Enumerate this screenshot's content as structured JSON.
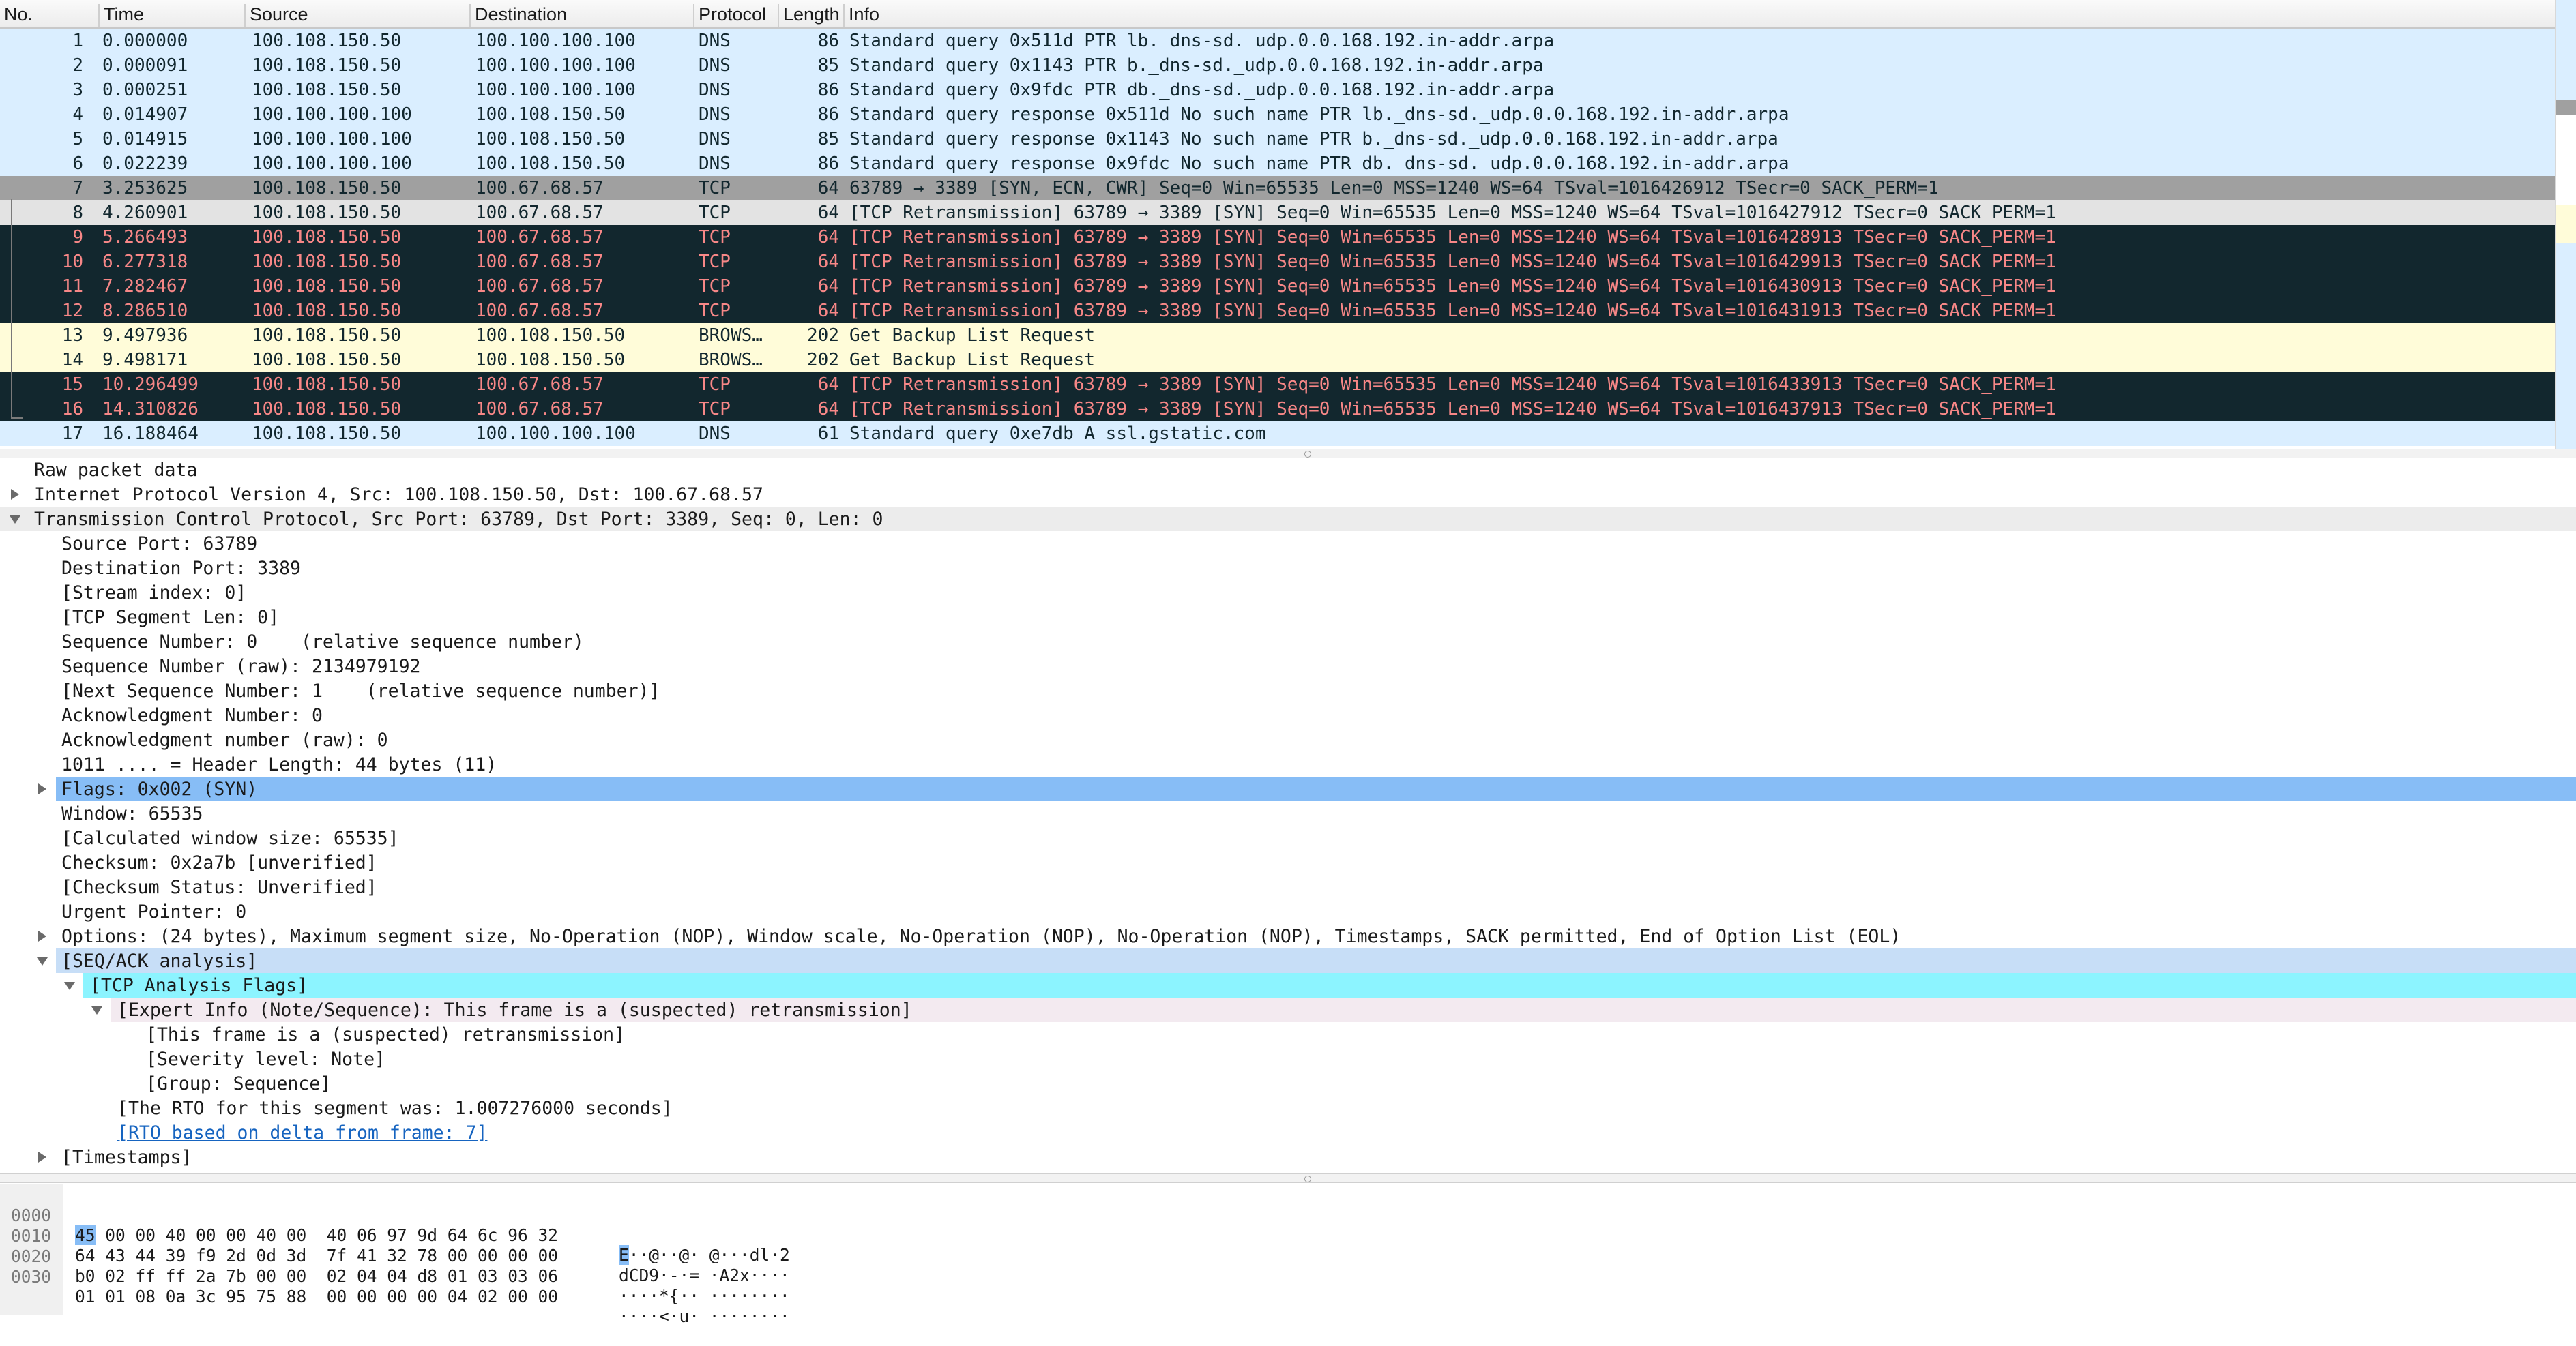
{
  "packet_list": {
    "columns": {
      "no": "No.",
      "time": "Time",
      "source": "Source",
      "destination": "Destination",
      "protocol": "Protocol",
      "length": "Length",
      "info": "Info"
    },
    "rows": [
      {
        "no": "1",
        "time": "0.000000",
        "src": "100.108.150.50",
        "dst": "100.100.100.100",
        "proto": "DNS",
        "len": "86",
        "info": "Standard query 0x511d PTR lb._dns-sd._udp.0.0.168.192.in-addr.arpa"
      },
      {
        "no": "2",
        "time": "0.000091",
        "src": "100.108.150.50",
        "dst": "100.100.100.100",
        "proto": "DNS",
        "len": "85",
        "info": "Standard query 0x1143 PTR b._dns-sd._udp.0.0.168.192.in-addr.arpa"
      },
      {
        "no": "3",
        "time": "0.000251",
        "src": "100.108.150.50",
        "dst": "100.100.100.100",
        "proto": "DNS",
        "len": "86",
        "info": "Standard query 0x9fdc PTR db._dns-sd._udp.0.0.168.192.in-addr.arpa"
      },
      {
        "no": "4",
        "time": "0.014907",
        "src": "100.100.100.100",
        "dst": "100.108.150.50",
        "proto": "DNS",
        "len": "86",
        "info": "Standard query response 0x511d No such name PTR lb._dns-sd._udp.0.0.168.192.in-addr.arpa"
      },
      {
        "no": "5",
        "time": "0.014915",
        "src": "100.100.100.100",
        "dst": "100.108.150.50",
        "proto": "DNS",
        "len": "85",
        "info": "Standard query response 0x1143 No such name PTR b._dns-sd._udp.0.0.168.192.in-addr.arpa"
      },
      {
        "no": "6",
        "time": "0.022239",
        "src": "100.100.100.100",
        "dst": "100.108.150.50",
        "proto": "DNS",
        "len": "86",
        "info": "Standard query response 0x9fdc No such name PTR db._dns-sd._udp.0.0.168.192.in-addr.arpa"
      },
      {
        "no": "7",
        "time": "3.253625",
        "src": "100.108.150.50",
        "dst": "100.67.68.57",
        "proto": "TCP",
        "len": "64",
        "info": "63789 → 3389 [SYN, ECN, CWR] Seq=0 Win=65535 Len=0 MSS=1240 WS=64 TSval=1016426912 TSecr=0 SACK_PERM=1"
      },
      {
        "no": "8",
        "time": "4.260901",
        "src": "100.108.150.50",
        "dst": "100.67.68.57",
        "proto": "TCP",
        "len": "64",
        "info": "[TCP Retransmission] 63789 → 3389 [SYN] Seq=0 Win=65535 Len=0 MSS=1240 WS=64 TSval=1016427912 TSecr=0 SACK_PERM=1"
      },
      {
        "no": "9",
        "time": "5.266493",
        "src": "100.108.150.50",
        "dst": "100.67.68.57",
        "proto": "TCP",
        "len": "64",
        "info": "[TCP Retransmission] 63789 → 3389 [SYN] Seq=0 Win=65535 Len=0 MSS=1240 WS=64 TSval=1016428913 TSecr=0 SACK_PERM=1"
      },
      {
        "no": "10",
        "time": "6.277318",
        "src": "100.108.150.50",
        "dst": "100.67.68.57",
        "proto": "TCP",
        "len": "64",
        "info": "[TCP Retransmission] 63789 → 3389 [SYN] Seq=0 Win=65535 Len=0 MSS=1240 WS=64 TSval=1016429913 TSecr=0 SACK_PERM=1"
      },
      {
        "no": "11",
        "time": "7.282467",
        "src": "100.108.150.50",
        "dst": "100.67.68.57",
        "proto": "TCP",
        "len": "64",
        "info": "[TCP Retransmission] 63789 → 3389 [SYN] Seq=0 Win=65535 Len=0 MSS=1240 WS=64 TSval=1016430913 TSecr=0 SACK_PERM=1"
      },
      {
        "no": "12",
        "time": "8.286510",
        "src": "100.108.150.50",
        "dst": "100.67.68.57",
        "proto": "TCP",
        "len": "64",
        "info": "[TCP Retransmission] 63789 → 3389 [SYN] Seq=0 Win=65535 Len=0 MSS=1240 WS=64 TSval=1016431913 TSecr=0 SACK_PERM=1"
      },
      {
        "no": "13",
        "time": "9.497936",
        "src": "100.108.150.50",
        "dst": "100.108.150.50",
        "proto": "BROWS…",
        "len": "202",
        "info": "Get Backup List Request"
      },
      {
        "no": "14",
        "time": "9.498171",
        "src": "100.108.150.50",
        "dst": "100.108.150.50",
        "proto": "BROWS…",
        "len": "202",
        "info": "Get Backup List Request"
      },
      {
        "no": "15",
        "time": "10.296499",
        "src": "100.108.150.50",
        "dst": "100.67.68.57",
        "proto": "TCP",
        "len": "64",
        "info": "[TCP Retransmission] 63789 → 3389 [SYN] Seq=0 Win=65535 Len=0 MSS=1240 WS=64 TSval=1016433913 TSecr=0 SACK_PERM=1"
      },
      {
        "no": "16",
        "time": "14.310826",
        "src": "100.108.150.50",
        "dst": "100.67.68.57",
        "proto": "TCP",
        "len": "64",
        "info": "[TCP Retransmission] 63789 → 3389 [SYN] Seq=0 Win=65535 Len=0 MSS=1240 WS=64 TSval=1016437913 TSecr=0 SACK_PERM=1"
      },
      {
        "no": "17",
        "time": "16.188464",
        "src": "100.108.150.50",
        "dst": "100.100.100.100",
        "proto": "DNS",
        "len": "61",
        "info": "Standard query 0xe7db A ssl.gstatic.com"
      }
    ]
  },
  "details": {
    "rows": [
      {
        "text": "Raw packet data"
      },
      {
        "text": "Internet Protocol Version 4, Src: 100.108.150.50, Dst: 100.67.68.57"
      },
      {
        "text": "Transmission Control Protocol, Src Port: 63789, Dst Port: 3389, Seq: 0, Len: 0"
      },
      {
        "text": "Source Port: 63789"
      },
      {
        "text": "Destination Port: 3389"
      },
      {
        "text": "[Stream index: 0]"
      },
      {
        "text": "[TCP Segment Len: 0]"
      },
      {
        "text": "Sequence Number: 0    (relative sequence number)"
      },
      {
        "text": "Sequence Number (raw): 2134979192"
      },
      {
        "text": "[Next Sequence Number: 1    (relative sequence number)]"
      },
      {
        "text": "Acknowledgment Number: 0"
      },
      {
        "text": "Acknowledgment number (raw): 0"
      },
      {
        "text": "1011 .... = Header Length: 44 bytes (11)"
      },
      {
        "text": "Flags: 0x002 (SYN)"
      },
      {
        "text": "Window: 65535"
      },
      {
        "text": "[Calculated window size: 65535]"
      },
      {
        "text": "Checksum: 0x2a7b [unverified]"
      },
      {
        "text": "[Checksum Status: Unverified]"
      },
      {
        "text": "Urgent Pointer: 0"
      },
      {
        "text": "Options: (24 bytes), Maximum segment size, No-Operation (NOP), Window scale, No-Operation (NOP), No-Operation (NOP), Timestamps, SACK permitted, End of Option List (EOL)"
      },
      {
        "text": "[SEQ/ACK analysis]"
      },
      {
        "text": "[TCP Analysis Flags]"
      },
      {
        "text": "[Expert Info (Note/Sequence): This frame is a (suspected) retransmission]"
      },
      {
        "text": "[This frame is a (suspected) retransmission]"
      },
      {
        "text": "[Severity level: Note]"
      },
      {
        "text": "[Group: Sequence]"
      },
      {
        "text": "[The RTO for this segment was: 1.007276000 seconds]"
      },
      {
        "text": "[RTO based on delta from frame: 7]"
      },
      {
        "text": "[Timestamps]"
      }
    ]
  },
  "bytes": {
    "rows": [
      {
        "offset": "0000",
        "hex_first": "45",
        "hex_rest": " 00 00 40 00 00 40 00  40 06 97 9d 64 6c 96 32",
        "ascii_first": "E",
        "ascii_rest": "··@··@· @···dl·2"
      },
      {
        "offset": "0010",
        "hex_first": "",
        "hex_rest": "64 43 44 39 f9 2d 0d 3d  7f 41 32 78 00 00 00 00",
        "ascii_first": "",
        "ascii_rest": "dCD9·-·= ·A2x····"
      },
      {
        "offset": "0020",
        "hex_first": "",
        "hex_rest": "b0 02 ff ff 2a 7b 00 00  02 04 04 d8 01 03 03 06",
        "ascii_first": "",
        "ascii_rest": "····*{·· ········"
      },
      {
        "offset": "0030",
        "hex_first": "",
        "hex_rest": "01 01 08 0a 3c 95 75 88  00 00 00 00 04 02 00 00",
        "ascii_first": "",
        "ascii_rest": "····<·u· ········"
      }
    ]
  },
  "colors": {
    "dns": "#daeeff",
    "tcp_syn": "#a0a0a0",
    "tcp_retrans_bg": "#12272e",
    "tcp_retrans_fg": "#f78787",
    "browser": "#fffcd9",
    "selected_field": "#87bdf6"
  }
}
